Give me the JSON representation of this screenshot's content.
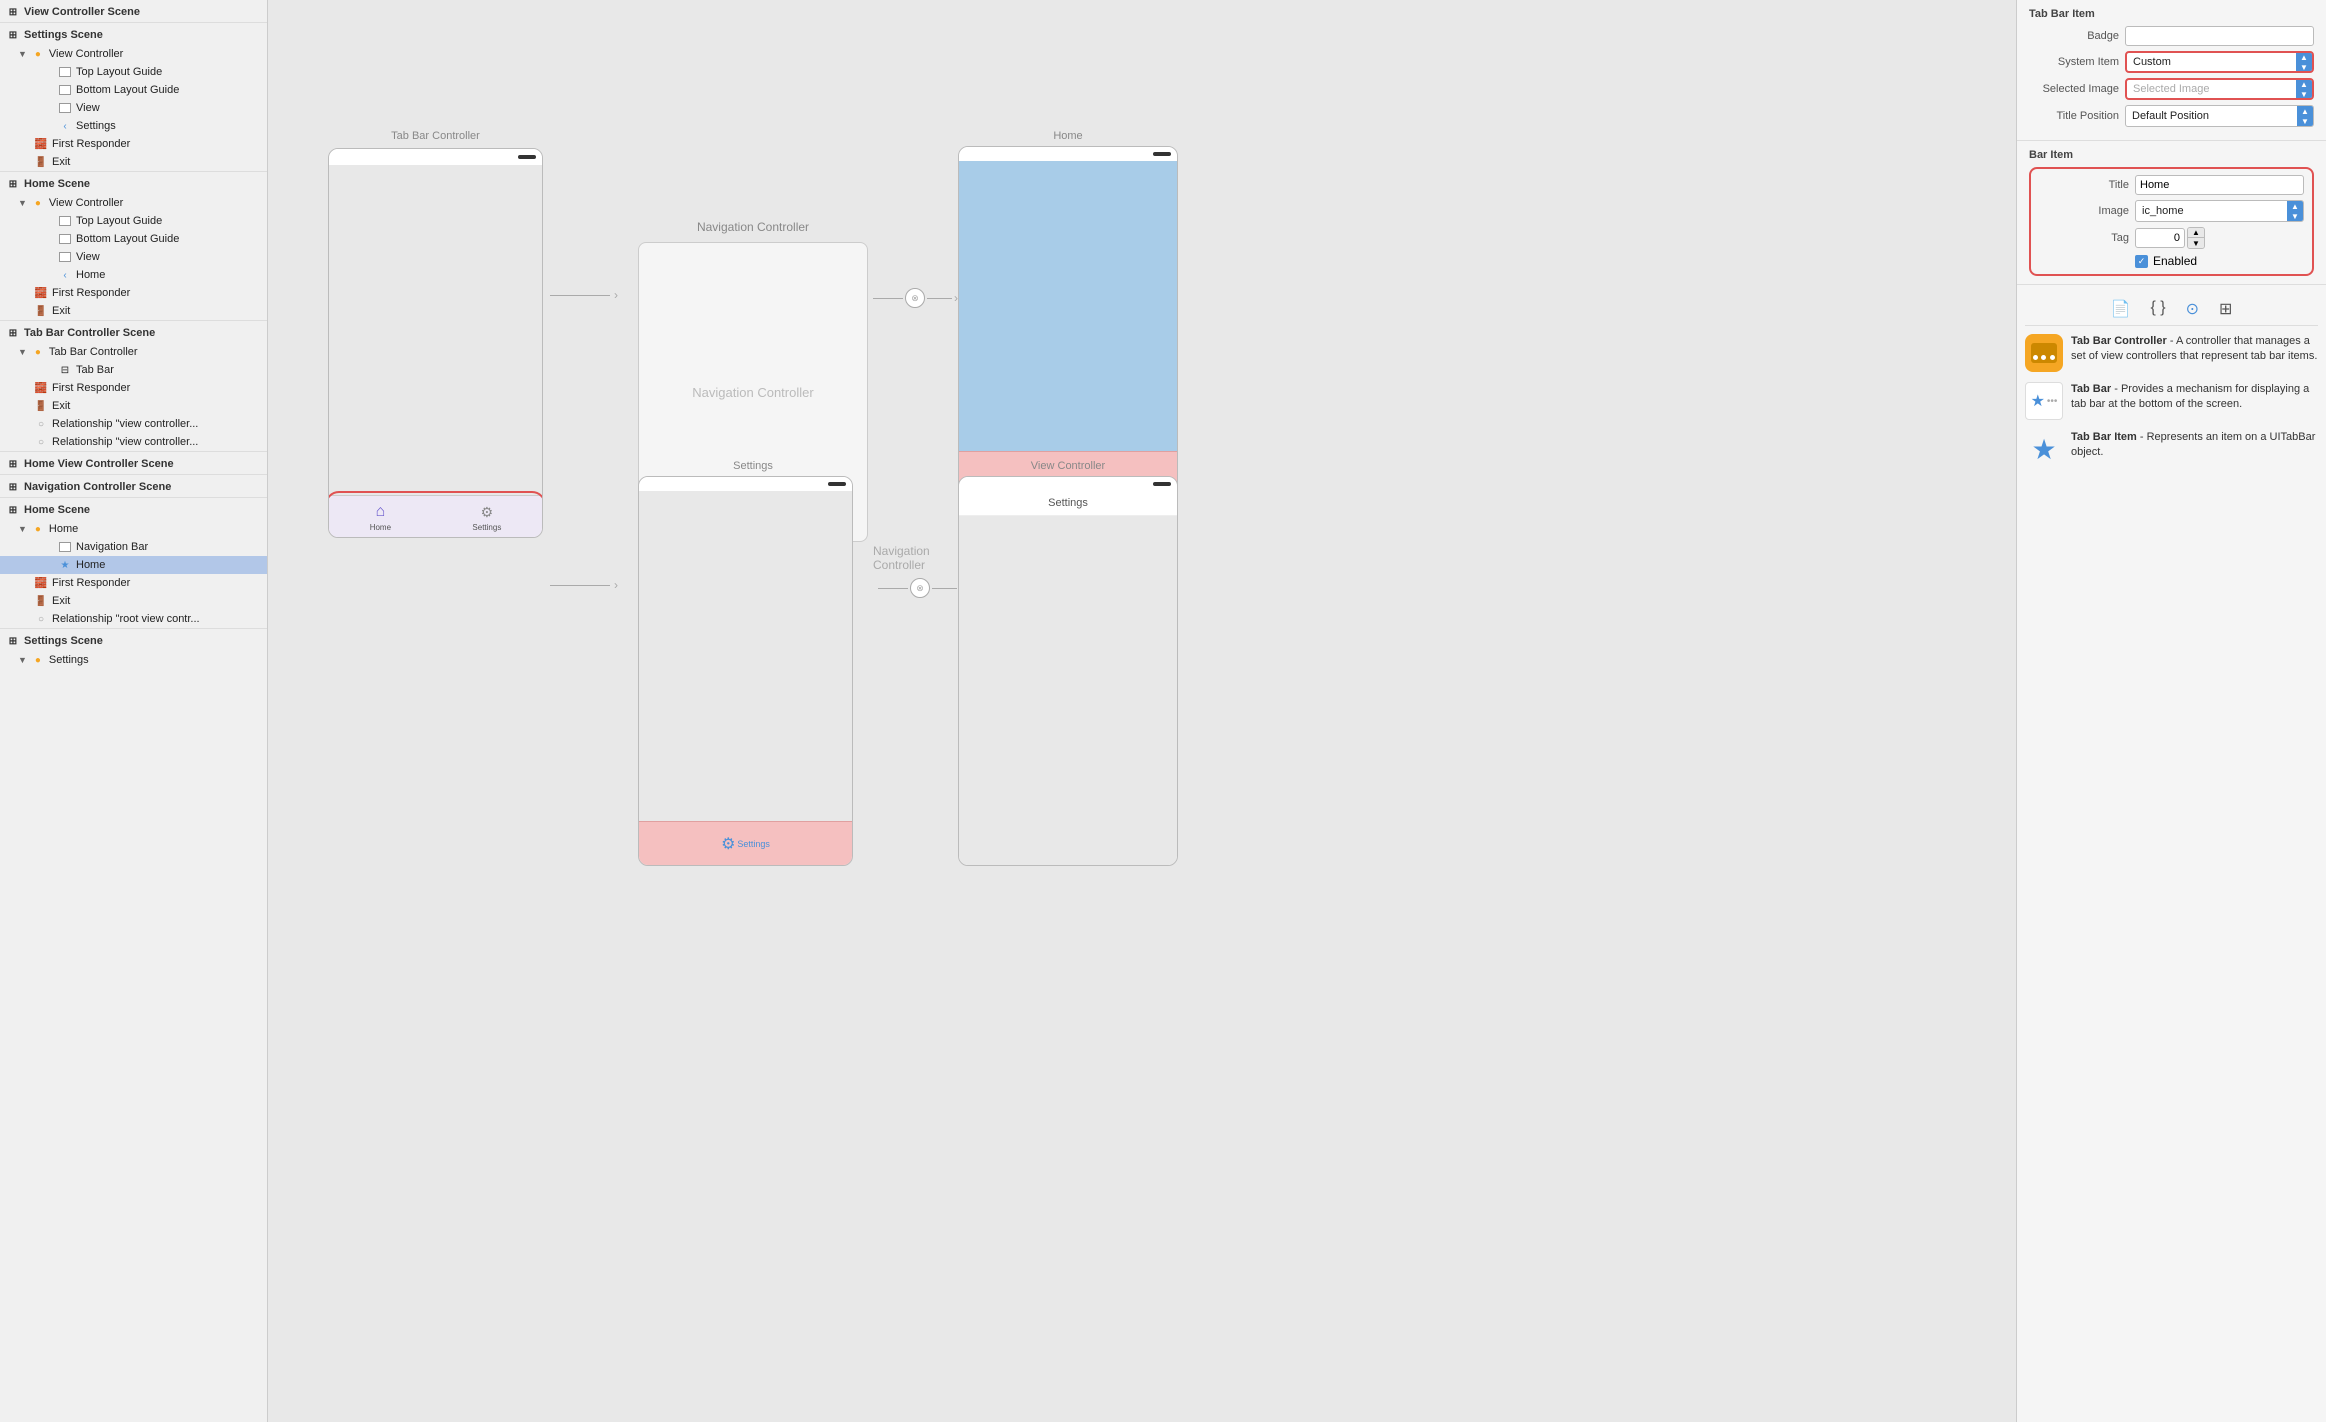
{
  "sidebar": {
    "sections": [
      {
        "name": "View Controller Scene",
        "icon": "⊞",
        "items": [
          {
            "label": "Settings Scene",
            "indent": 0,
            "icon": "⊞",
            "type": "scene"
          },
          {
            "label": "View Controller",
            "indent": 1,
            "icon": "●",
            "type": "vc",
            "color": "yellow",
            "disclosure": true
          },
          {
            "label": "Top Layout Guide",
            "indent": 2,
            "icon": "rect",
            "type": "layout"
          },
          {
            "label": "Bottom Layout Guide",
            "indent": 2,
            "icon": "rect",
            "type": "layout"
          },
          {
            "label": "View",
            "indent": 2,
            "icon": "rect",
            "type": "view"
          },
          {
            "label": "Settings",
            "indent": 2,
            "icon": "chevron",
            "type": "chevron"
          },
          {
            "label": "First Responder",
            "indent": 1,
            "icon": "🧱",
            "type": "responder"
          },
          {
            "label": "Exit",
            "indent": 1,
            "icon": "🚪",
            "type": "exit"
          }
        ]
      },
      {
        "name": "Home Scene",
        "icon": "⊞",
        "items": [
          {
            "label": "View Controller",
            "indent": 1,
            "icon": "●",
            "type": "vc",
            "color": "yellow",
            "disclosure": true
          },
          {
            "label": "Top Layout Guide",
            "indent": 2,
            "icon": "rect",
            "type": "layout"
          },
          {
            "label": "Bottom Layout Guide",
            "indent": 2,
            "icon": "rect",
            "type": "layout"
          },
          {
            "label": "View",
            "indent": 2,
            "icon": "rect",
            "type": "view"
          },
          {
            "label": "Home",
            "indent": 2,
            "icon": "chevron",
            "type": "chevron"
          },
          {
            "label": "First Responder",
            "indent": 1,
            "icon": "🧱",
            "type": "responder"
          },
          {
            "label": "Exit",
            "indent": 1,
            "icon": "🚪",
            "type": "exit"
          }
        ]
      },
      {
        "name": "Tab Bar Controller Scene",
        "icon": "⊞",
        "items": [
          {
            "label": "Tab Bar Controller",
            "indent": 1,
            "icon": "●",
            "type": "vc",
            "color": "yellow",
            "disclosure": true
          },
          {
            "label": "Tab Bar",
            "indent": 2,
            "icon": "tab",
            "type": "tabbar"
          },
          {
            "label": "First Responder",
            "indent": 1,
            "icon": "🧱",
            "type": "responder"
          },
          {
            "label": "Exit",
            "indent": 1,
            "icon": "🚪",
            "type": "exit"
          },
          {
            "label": "Relationship \"view controller...",
            "indent": 1,
            "icon": "○",
            "type": "rel"
          },
          {
            "label": "Relationship \"view controller...",
            "indent": 1,
            "icon": "○",
            "type": "rel"
          }
        ]
      },
      {
        "name": "Home View Controller Scene",
        "icon": "⊞",
        "items": []
      },
      {
        "name": "Navigation Controller Scene",
        "icon": "⊞",
        "items": []
      },
      {
        "name": "Home Scene",
        "icon": "⊞",
        "items": [
          {
            "label": "Home",
            "indent": 1,
            "icon": "●",
            "type": "vc",
            "color": "yellow",
            "disclosure": true
          },
          {
            "label": "Navigation Bar",
            "indent": 2,
            "icon": "rect",
            "type": "navBar"
          },
          {
            "label": "Home",
            "indent": 2,
            "icon": "★",
            "type": "star",
            "selected": true
          },
          {
            "label": "First Responder",
            "indent": 1,
            "icon": "🧱",
            "type": "responder"
          },
          {
            "label": "Exit",
            "indent": 1,
            "icon": "🚪",
            "type": "exit"
          },
          {
            "label": "Relationship \"root view contr...",
            "indent": 1,
            "icon": "○",
            "type": "rel"
          }
        ]
      },
      {
        "name": "Settings Scene",
        "icon": "⊞",
        "items": [
          {
            "label": "Settings",
            "indent": 1,
            "icon": "●",
            "type": "vc",
            "color": "yellow",
            "disclosure": true
          }
        ]
      }
    ]
  },
  "canvas": {
    "tab_bar_controller_label": "Tab Bar Controller",
    "navigation_controller_label": "Navigation Controller",
    "navigation_controller_label2": "Navigation Controller",
    "home_title": "Home",
    "settings_title": "Settings",
    "view_controller_title": "View Controller"
  },
  "right_panel": {
    "section_title": "Tab Bar Item",
    "badge_label": "Badge",
    "system_item_label": "System Item",
    "system_item_value": "Custom",
    "selected_image_label": "Selected Image",
    "selected_image_value": "Selected Image",
    "title_position_label": "Title Position",
    "title_position_value": "Default Position",
    "bar_item_title": "Bar Item",
    "bar_item_title_label": "Title",
    "bar_item_title_value": "Home",
    "bar_item_image_label": "Image",
    "bar_item_image_value": "ic_home",
    "bar_item_tag_label": "Tag",
    "bar_item_tag_value": "0",
    "bar_item_enabled_label": "Enabled"
  },
  "info_panel": {
    "items": [
      {
        "title": "Tab Bar Controller",
        "description": "A controller that manages a set of view controllers that represent tab bar items."
      },
      {
        "title": "Tab Bar",
        "description": "Provides a mechanism for displaying a tab bar at the bottom of the screen."
      },
      {
        "title": "Tab Bar Item",
        "description": "Represents an item on a UITabBar object."
      }
    ]
  }
}
